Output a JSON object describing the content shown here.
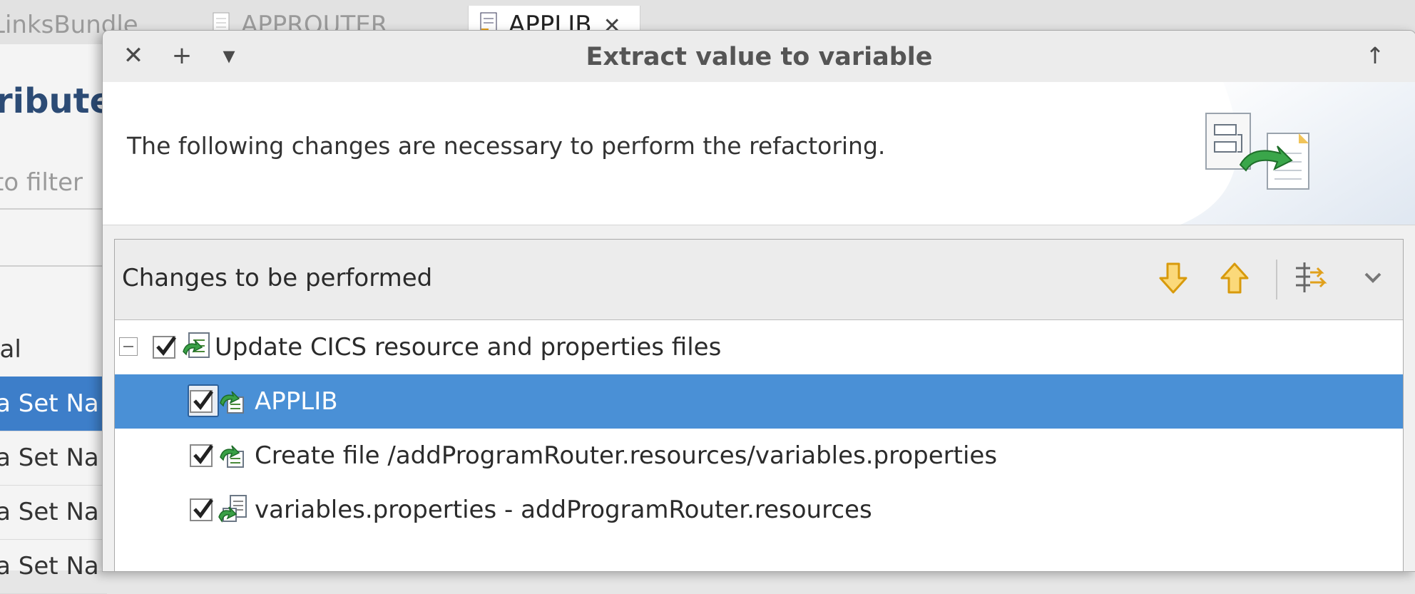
{
  "editor": {
    "tabs": [
      {
        "label": "LinksBundle"
      },
      {
        "label": "APPROUTER"
      },
      {
        "label": "APPLIB",
        "close": "✕"
      }
    ],
    "section_title": "ributes",
    "filter_placeholder": "to filter",
    "rows": [
      {
        "label": "ocal"
      },
      {
        "label": "ata Set Na"
      },
      {
        "label": "ata Set Na"
      },
      {
        "label": "ata Set Na"
      },
      {
        "label": "ata Set Na"
      }
    ]
  },
  "dialog": {
    "title": "Extract value to variable",
    "buttons": {
      "close": "✕",
      "add": "+",
      "menu": "▾",
      "maximize": "↑"
    },
    "message": "The following changes are necessary to perform the refactoring.",
    "changes_panel": {
      "title": "Changes to be performed",
      "toolbar_icons": [
        "arrow-down-icon",
        "arrow-up-icon",
        "filter-changes-icon",
        "chevron-down-icon"
      ]
    },
    "tree": {
      "root": {
        "label": "Update CICS resource and properties files",
        "checked": true,
        "expanded": true
      },
      "children": [
        {
          "label": "APPLIB",
          "checked": true,
          "selected": true
        },
        {
          "label": "Create file /addProgramRouter.resources/variables.properties",
          "checked": true
        },
        {
          "label": "variables.properties - addProgramRouter.resources",
          "checked": true
        }
      ]
    }
  },
  "colors": {
    "selection": "#4a90d6",
    "accent": "#f2b31e",
    "title": "#2c4b75"
  }
}
